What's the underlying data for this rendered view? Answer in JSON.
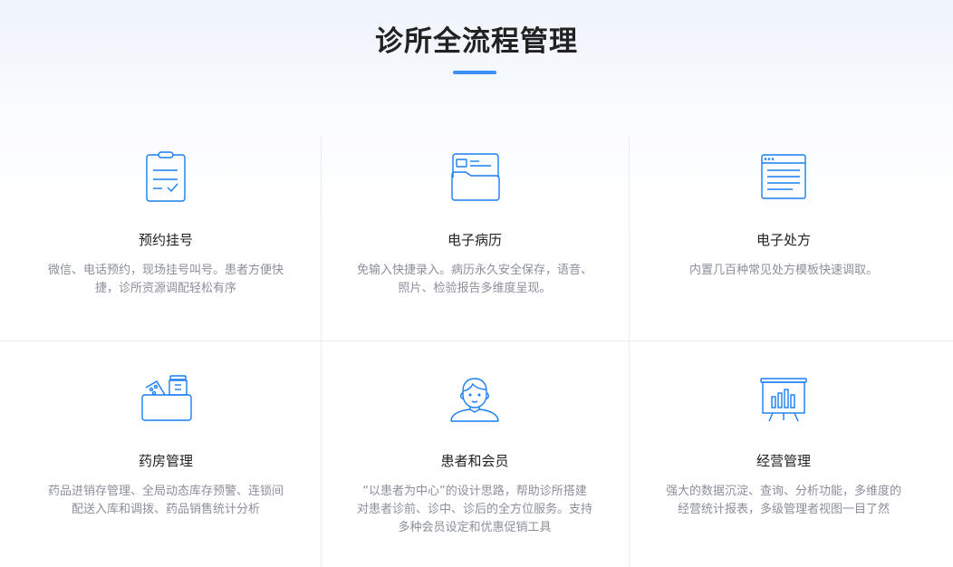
{
  "title": "诊所全流程管理",
  "accent": "#1a7ef2",
  "features": [
    {
      "icon": "clipboard-icon",
      "title": "预约挂号",
      "desc": "微信、电话预约，现场挂号叫号。患者方便快捷，诊所资源调配轻松有序"
    },
    {
      "icon": "folder-record-icon",
      "title": "电子病历",
      "desc": "免输入快捷录入。病历永久安全保存，语音、照片、检验报告多维度呈现。"
    },
    {
      "icon": "prescription-window-icon",
      "title": "电子处方",
      "desc": "内置几百种常见处方模板快速调取。"
    },
    {
      "icon": "medicine-box-icon",
      "title": "药房管理",
      "desc": "药品进销存管理、全局动态库存预警、连锁间配送入库和调拨、药品销售统计分析"
    },
    {
      "icon": "patient-avatar-icon",
      "title": "患者和会员",
      "desc": "“以患者为中心”的设计思路，帮助诊所搭建对患者诊前、诊中、诊后的全方位服务。支持多种会员设定和优惠促销工具"
    },
    {
      "icon": "chart-board-icon",
      "title": "经营管理",
      "desc": "强大的数据沉淀、查询、分析功能，多维度的经营统计报表，多级管理者视图一目了然"
    }
  ]
}
